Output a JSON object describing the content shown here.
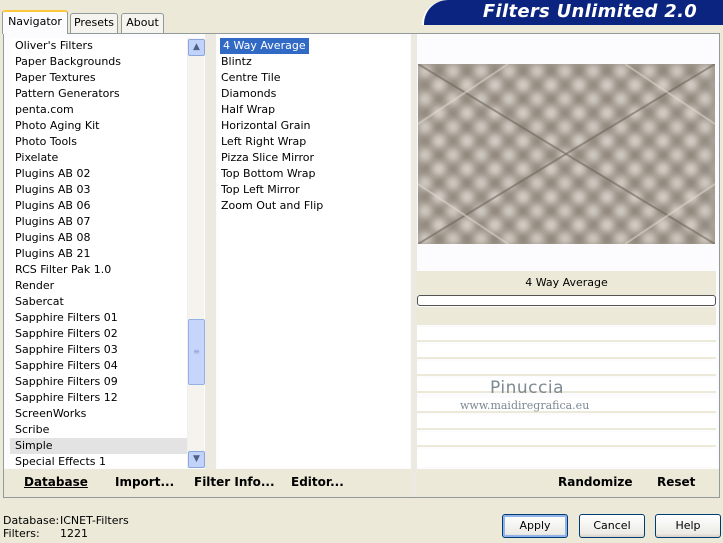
{
  "tabs": [
    {
      "label": "Navigator",
      "active": true
    },
    {
      "label": "Presets",
      "active": false
    },
    {
      "label": "About",
      "active": false
    }
  ],
  "banner": {
    "title": "Filters Unlimited 2.0"
  },
  "categories": [
    "Oliver's Filters",
    "Paper Backgrounds",
    "Paper Textures",
    "Pattern Generators",
    "penta.com",
    "Photo Aging Kit",
    "Photo Tools",
    "Pixelate",
    "Plugins AB 02",
    "Plugins AB 03",
    "Plugins AB 06",
    "Plugins AB 07",
    "Plugins AB 08",
    "Plugins AB 21",
    "RCS Filter Pak 1.0",
    "Render",
    "Sabercat",
    "Sapphire Filters 01",
    "Sapphire Filters 02",
    "Sapphire Filters 03",
    "Sapphire Filters 04",
    "Sapphire Filters 09",
    "Sapphire Filters 12",
    "ScreenWorks",
    "Scribe",
    "Simple",
    "Special Effects 1"
  ],
  "selected_category": "Simple",
  "filters": [
    "4 Way Average",
    "Blintz",
    "Centre Tile",
    "Diamonds",
    "Half Wrap",
    "Horizontal Grain",
    "Left Right Wrap",
    "Pizza Slice Mirror",
    "Top Bottom Wrap",
    "Top Left Mirror",
    "Zoom Out and Flip"
  ],
  "selected_filter": "4 Way Average",
  "preview": {
    "filter_name": "4 Way Average",
    "progress": 0
  },
  "watermark": {
    "line1": "Pinuccia",
    "line2": "www.maidiregrafica.eu"
  },
  "commands": {
    "database": "Database",
    "import": "Import...",
    "filter_info": "Filter Info...",
    "editor": "Editor...",
    "randomize": "Randomize",
    "reset": "Reset"
  },
  "status": {
    "database_label": "Database:",
    "database_value": "ICNET-Filters",
    "filters_label": "Filters:",
    "filters_value": "1221"
  },
  "buttons": {
    "apply": "Apply",
    "cancel": "Cancel",
    "help": "Help"
  },
  "icons": {
    "scroll_up": "chevron-up-icon",
    "scroll_down": "chevron-down-icon",
    "scroll_grip": "grip-icon"
  },
  "colors": {
    "selection": "#316ac5",
    "banner": "#0b2480",
    "panel_bg": "#ece9d8"
  }
}
